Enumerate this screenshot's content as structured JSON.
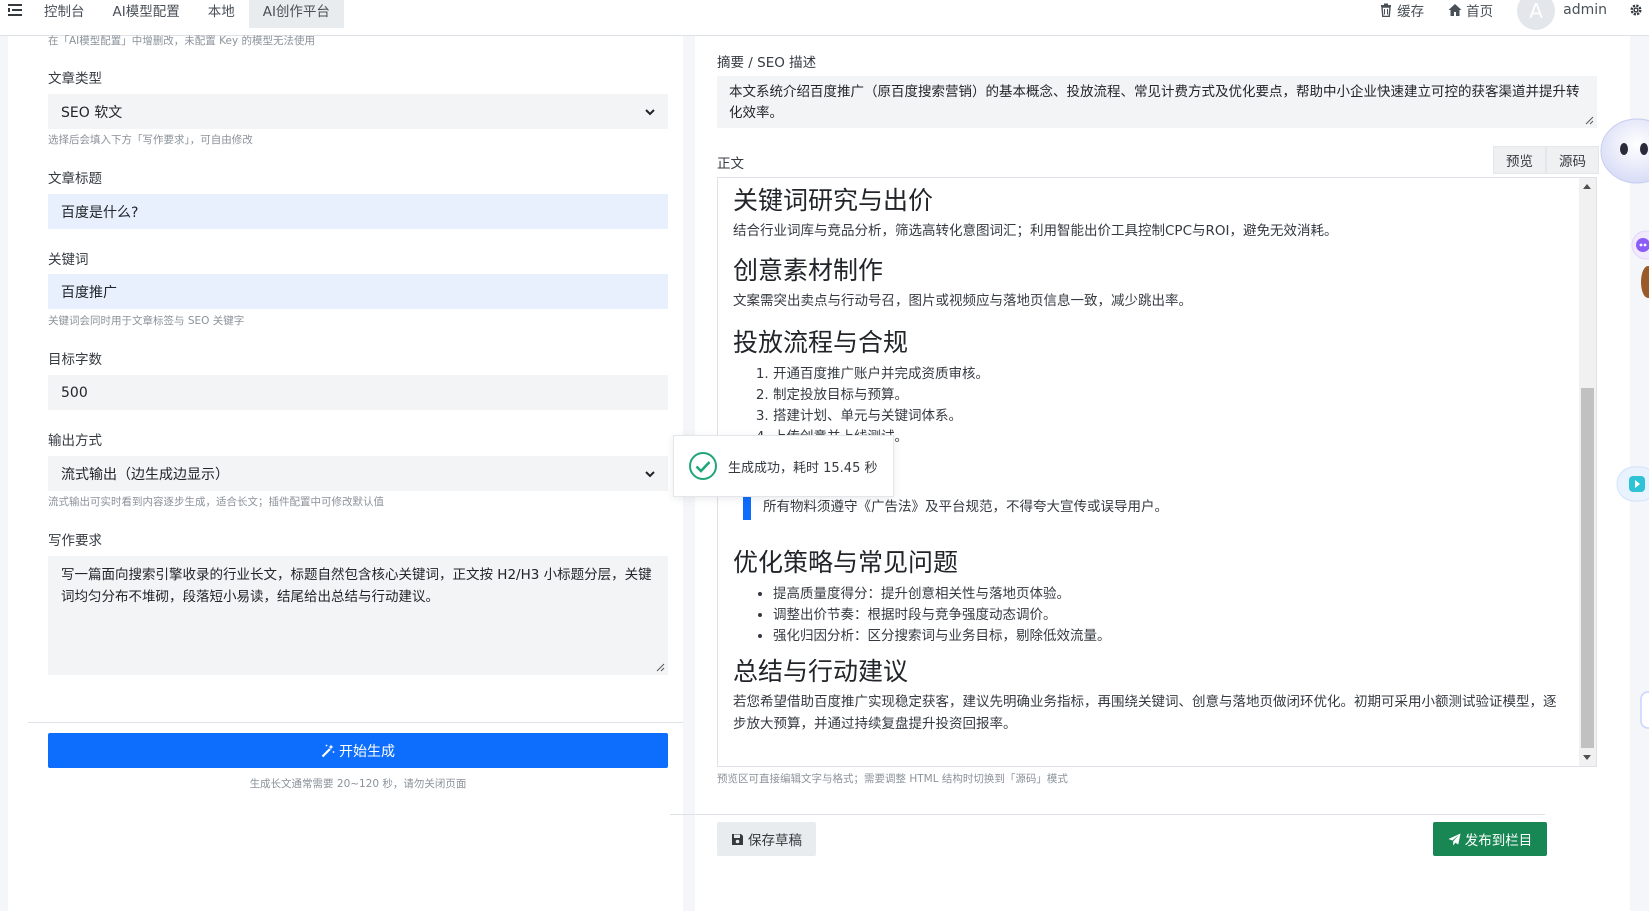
{
  "topnav": {
    "tabs": [
      {
        "label": "控制台",
        "active": false
      },
      {
        "label": "AI模型配置",
        "active": false
      },
      {
        "label": "本地",
        "active": false
      },
      {
        "label": "AI创作平台",
        "active": true
      }
    ],
    "cache_label": "缓存",
    "home_label": "首页",
    "avatar_initial": "A",
    "user_name": "admin"
  },
  "left": {
    "model_hint": "在「AI模型配置」中增删改，未配置 Key 的模型无法使用",
    "article_type": {
      "label": "文章类型",
      "value": "SEO 软文",
      "hint": "选择后会填入下方「写作要求」，可自由修改"
    },
    "title": {
      "label": "文章标题",
      "value": "百度是什么?"
    },
    "keywords": {
      "label": "关键词",
      "value": "百度推广",
      "hint": "关键词会同时用于文章标签与 SEO 关键字"
    },
    "word_count": {
      "label": "目标字数",
      "value": "500"
    },
    "output": {
      "label": "输出方式",
      "value": "流式输出（边生成边显示）",
      "hint": "流式输出可实时看到内容逐步生成，适合长文；插件配置中可修改默认值"
    },
    "requirements": {
      "label": "写作要求",
      "value": "写一篇面向搜索引擎收录的行业长文，标题自然包含核心关键词，正文按 H2/H3 小标题分层，关键词均匀分布不堆砌，段落短小易读，结尾给出总结与行动建议。"
    },
    "generate_label": "开始生成",
    "generate_hint": "生成长文通常需要 20~120 秒，请勿关闭页面"
  },
  "right": {
    "summary_label": "摘要 / SEO 描述",
    "summary_value": "本文系统介绍百度推广（原百度搜索营销）的基本概念、投放流程、常见计费方式及优化要点，帮助中小企业快速建立可控的获客渠道并提升转化效率。",
    "body_label": "正文",
    "preview_tab": "预览",
    "source_tab": "源码",
    "content": {
      "h_keywords": "关键词研究与出价",
      "p_keywords": "结合行业词库与竞品分析，筛选高转化意图词汇；利用智能出价工具控制CPC与ROI，避免无效消耗。",
      "h_creative": "创意素材制作",
      "p_creative": "文案需突出卖点与行动号召，图片或视频应与落地页信息一致，减少跳出率。",
      "h_process": "投放流程与合规",
      "steps": [
        "开通百度推广账户并完成资质审核。",
        "制定投放目标与预算。",
        "搭建计划、单元与关键词体系。",
        "上传创意并上线测试。"
      ],
      "quote": "所有物料须遵守《广告法》及平台规范，不得夸大宣传或误导用户。",
      "h_optimize": "优化策略与常见问题",
      "tips": [
        "提高质量度得分：提升创意相关性与落地页体验。",
        "调整出价节奏：根据时段与竞争强度动态调价。",
        "强化归因分析：区分搜索词与业务目标，剔除低效流量。"
      ],
      "h_summary": "总结与行动建议",
      "p_summary": "若您希望借助百度推广实现稳定获客，建议先明确业务指标，再围绕关键词、创意与落地页做闭环优化。初期可采用小额测试验证模型，逐步放大预算，并通过持续复盘提升投资回报率。"
    },
    "editor_hint": "预览区可直接编辑文字与格式；需要调整 HTML 结构时切换到「源码」模式",
    "save_label": "保存草稿",
    "publish_label": "发布到栏目"
  },
  "toast": {
    "message": "生成成功，耗时 15.45 秒"
  },
  "colors": {
    "primary": "#0d6efd",
    "success": "#198754",
    "input_bg": "#f3f4f6",
    "input_focus_bg": "#e8f0fe"
  }
}
